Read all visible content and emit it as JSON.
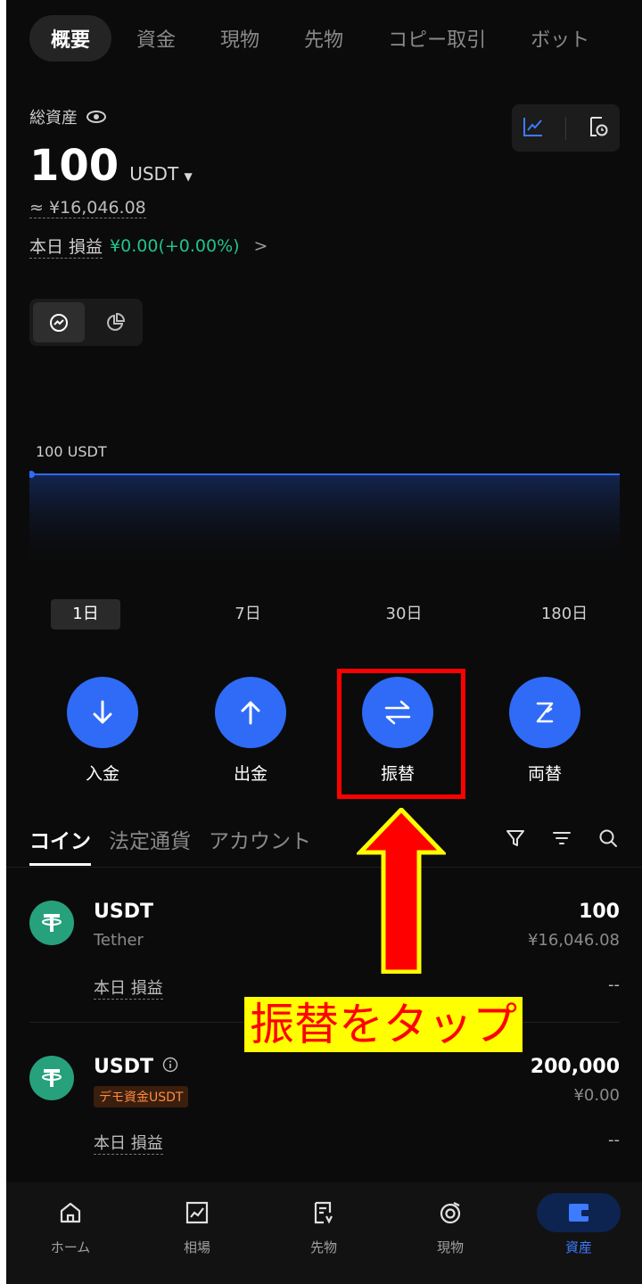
{
  "top_tabs": [
    "概要",
    "資金",
    "現物",
    "先物",
    "コピー取引",
    "ボット"
  ],
  "summary": {
    "total_assets_label": "総資産",
    "balance": "100",
    "balance_unit": "USDT",
    "approx_jpy": "≈ ¥16,046.08",
    "pnl_label": "本日 損益",
    "pnl_value": "¥0.00(+0.00%)",
    "pnl_arrow": ">"
  },
  "chart_data": {
    "type": "area",
    "series": [
      {
        "values": [
          100,
          100,
          100,
          100
        ]
      }
    ],
    "label": "100 USDT",
    "color": "#2f6bf6"
  },
  "ranges": [
    "1日",
    "7日",
    "30日",
    "180日"
  ],
  "selected_range": "1日",
  "actions": {
    "deposit": "入金",
    "withdraw": "出金",
    "transfer": "振替",
    "convert": "両替"
  },
  "list_tabs": [
    "コイン",
    "法定通貨",
    "アカウント"
  ],
  "coins": [
    {
      "symbol": "USDT",
      "name": "Tether",
      "amount": "100",
      "jpy": "¥16,046.08",
      "pnl_label": "本日 損益",
      "pnl_value": "--"
    },
    {
      "symbol": "USDT",
      "badge": "デモ資金USDT",
      "amount": "200,000",
      "jpy": "¥0.00",
      "pnl_label": "本日 損益",
      "pnl_value": "--"
    }
  ],
  "annotation": {
    "text": "振替をタップ",
    "arrow_color": "#ff0000",
    "highlight_color": "#ff0000",
    "text_background": "#ffff00"
  },
  "bottom_nav": [
    "ホーム",
    "相場",
    "先物",
    "現物",
    "資産"
  ],
  "active_nav": "資産"
}
